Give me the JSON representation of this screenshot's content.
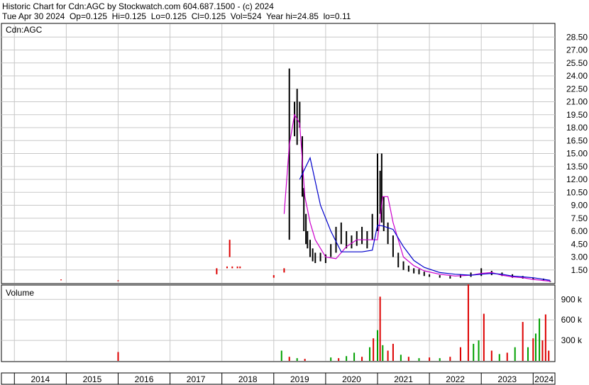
{
  "header": {
    "line1": "Historic Chart for Cdn:AGC by Stockwatch.com 604.687.1500 - (c) 2024",
    "line2": "Tue Apr 30 2024  Op=0.125  Hi=0.125  Lo=0.125  Cl=0.125  Vol=524  Year hi=24.85  lo=0.11"
  },
  "colors": {
    "grid": "#c8c8c8",
    "price_bars": "#000000",
    "ma_short": "#cc00cc",
    "ma_long": "#0000cc",
    "volume_up": "#00a000",
    "volume_down": "#dd0000",
    "early_ticks": "#dd0000"
  },
  "chart_data": [
    {
      "type": "line",
      "panel": "price",
      "title": "Cdn:AGC",
      "ylim": [
        0,
        30
      ],
      "y_ticks": [
        "1.50",
        "3.00",
        "4.50",
        "6.00",
        "7.50",
        "9.00",
        "10.50",
        "12.00",
        "13.50",
        "15.00",
        "16.50",
        "18.00",
        "19.50",
        "21.00",
        "22.50",
        "24.00",
        "25.50",
        "27.00",
        "28.50"
      ],
      "x_ticks": [
        "2014",
        "2015",
        "2016",
        "2017",
        "2018",
        "2019",
        "2020",
        "2021",
        "2022",
        "2023",
        "2024"
      ],
      "series": [
        {
          "style": "price-range",
          "x": [
            2014.9,
            2016.0,
            2017.9,
            2018.1,
            2018.15,
            2018.2,
            2018.3,
            2018.35,
            2019.0,
            2019.2,
            2019.3,
            2019.4,
            2019.45,
            2019.5,
            2019.55,
            2019.58,
            2019.62,
            2019.65,
            2019.7,
            2019.75,
            2019.8,
            2019.9,
            2020.0,
            2020.1,
            2020.2,
            2020.3,
            2020.4,
            2020.5,
            2020.6,
            2020.7,
            2020.8,
            2020.9,
            2021.0,
            2021.05,
            2021.08,
            2021.12,
            2021.2,
            2021.3,
            2021.4,
            2021.5,
            2021.6,
            2021.7,
            2021.8,
            2021.9,
            2022.0,
            2022.2,
            2022.4,
            2022.6,
            2022.8,
            2023.0,
            2023.2,
            2023.4,
            2023.6,
            2023.8,
            2024.0,
            2024.2,
            2024.33
          ],
          "low": [
            0.3,
            0.2,
            1.0,
            1.7,
            3.0,
            1.7,
            1.7,
            1.7,
            0.6,
            1.2,
            5.0,
            17.0,
            16.0,
            18.0,
            10.0,
            6.0,
            4.5,
            4.0,
            3.0,
            2.5,
            2.3,
            2.5,
            2.3,
            3.0,
            3.5,
            4.5,
            4.0,
            4.0,
            4.3,
            4.5,
            4.0,
            5.0,
            6.0,
            8.0,
            7.0,
            6.0,
            4.5,
            3.0,
            1.8,
            1.5,
            1.3,
            1.1,
            1.0,
            0.8,
            0.7,
            0.6,
            0.5,
            0.6,
            0.7,
            0.8,
            0.9,
            0.8,
            0.6,
            0.5,
            0.4,
            0.3,
            0.11
          ],
          "high": [
            0.4,
            0.3,
            1.7,
            1.9,
            5.0,
            1.9,
            1.9,
            1.9,
            0.9,
            1.7,
            24.85,
            21.0,
            22.5,
            21.0,
            17.0,
            11.0,
            8.0,
            6.0,
            5.0,
            4.0,
            3.5,
            3.5,
            3.3,
            4.5,
            6.5,
            7.0,
            6.0,
            5.5,
            6.0,
            6.5,
            6.0,
            8.0,
            15.0,
            13.0,
            15.0,
            10.0,
            7.0,
            5.5,
            3.5,
            2.5,
            2.0,
            1.7,
            1.6,
            1.3,
            1.0,
            0.9,
            0.8,
            1.0,
            1.2,
            1.7,
            1.4,
            1.2,
            1.0,
            0.8,
            0.6,
            0.5,
            0.2
          ]
        },
        {
          "name": "",
          "style": "ma-short",
          "x": [
            2019.2,
            2019.3,
            2019.4,
            2019.5,
            2019.6,
            2019.7,
            2019.8,
            2019.9,
            2020.0,
            2020.2,
            2020.4,
            2020.6,
            2020.8,
            2021.0,
            2021.1,
            2021.2,
            2021.3,
            2021.5,
            2021.7,
            2021.9,
            2022.2,
            2022.5,
            2022.8,
            2023.0,
            2023.2,
            2023.4,
            2023.6,
            2023.8,
            2024.0,
            2024.33
          ],
          "values": [
            8.0,
            16.0,
            19.5,
            18.5,
            10.0,
            7.0,
            5.0,
            4.0,
            3.0,
            2.8,
            4.2,
            5.0,
            5.0,
            5.0,
            10.0,
            10.0,
            7.0,
            3.0,
            2.0,
            1.4,
            1.0,
            0.8,
            0.9,
            1.1,
            1.2,
            0.9,
            0.7,
            0.6,
            0.4,
            0.2
          ]
        },
        {
          "name": "",
          "style": "ma-long",
          "x": [
            2019.5,
            2019.7,
            2019.9,
            2020.1,
            2020.3,
            2020.5,
            2020.7,
            2020.9,
            2021.0,
            2021.1,
            2021.3,
            2021.5,
            2021.7,
            2021.9,
            2022.2,
            2022.5,
            2022.8,
            2023.0,
            2023.2,
            2023.4,
            2023.6,
            2023.8,
            2024.0,
            2024.33
          ],
          "values": [
            12.0,
            14.5,
            9.0,
            6.0,
            3.6,
            3.6,
            3.6,
            3.8,
            6.7,
            6.6,
            6.2,
            4.2,
            2.6,
            1.8,
            1.2,
            1.0,
            0.9,
            1.0,
            1.1,
            1.0,
            0.8,
            0.7,
            0.6,
            0.3
          ]
        }
      ]
    },
    {
      "type": "bar",
      "panel": "volume",
      "title": "Volume",
      "ylim": [
        0,
        1100000
      ],
      "y_ticks": [
        "300 k",
        "600 k",
        "900 k"
      ],
      "bars": [
        {
          "x": 2016.0,
          "value": 130000,
          "dir": "down"
        },
        {
          "x": 2019.15,
          "value": 150000,
          "dir": "up"
        },
        {
          "x": 2019.3,
          "value": 60000,
          "dir": "down"
        },
        {
          "x": 2019.45,
          "value": 40000,
          "dir": "up"
        },
        {
          "x": 2019.6,
          "value": 30000,
          "dir": "down"
        },
        {
          "x": 2020.1,
          "value": 50000,
          "dir": "up"
        },
        {
          "x": 2020.25,
          "value": 40000,
          "dir": "down"
        },
        {
          "x": 2020.4,
          "value": 70000,
          "dir": "up"
        },
        {
          "x": 2020.55,
          "value": 120000,
          "dir": "up"
        },
        {
          "x": 2020.7,
          "value": 60000,
          "dir": "down"
        },
        {
          "x": 2020.85,
          "value": 200000,
          "dir": "up"
        },
        {
          "x": 2020.92,
          "value": 330000,
          "dir": "down"
        },
        {
          "x": 2021.0,
          "value": 450000,
          "dir": "up"
        },
        {
          "x": 2021.05,
          "value": 940000,
          "dir": "down"
        },
        {
          "x": 2021.1,
          "value": 230000,
          "dir": "up"
        },
        {
          "x": 2021.2,
          "value": 150000,
          "dir": "down"
        },
        {
          "x": 2021.3,
          "value": 250000,
          "dir": "down"
        },
        {
          "x": 2021.45,
          "value": 90000,
          "dir": "up"
        },
        {
          "x": 2021.6,
          "value": 60000,
          "dir": "down"
        },
        {
          "x": 2021.8,
          "value": 40000,
          "dir": "up"
        },
        {
          "x": 2022.0,
          "value": 50000,
          "dir": "down"
        },
        {
          "x": 2022.2,
          "value": 40000,
          "dir": "up"
        },
        {
          "x": 2022.4,
          "value": 60000,
          "dir": "down"
        },
        {
          "x": 2022.6,
          "value": 200000,
          "dir": "down"
        },
        {
          "x": 2022.75,
          "value": 1120000,
          "dir": "down"
        },
        {
          "x": 2022.85,
          "value": 250000,
          "dir": "up"
        },
        {
          "x": 2022.95,
          "value": 300000,
          "dir": "up"
        },
        {
          "x": 2023.05,
          "value": 690000,
          "dir": "down"
        },
        {
          "x": 2023.2,
          "value": 150000,
          "dir": "down"
        },
        {
          "x": 2023.35,
          "value": 100000,
          "dir": "up"
        },
        {
          "x": 2023.5,
          "value": 120000,
          "dir": "down"
        },
        {
          "x": 2023.65,
          "value": 200000,
          "dir": "up"
        },
        {
          "x": 2023.8,
          "value": 570000,
          "dir": "down"
        },
        {
          "x": 2023.9,
          "value": 200000,
          "dir": "up"
        },
        {
          "x": 2024.0,
          "value": 330000,
          "dir": "down"
        },
        {
          "x": 2024.05,
          "value": 400000,
          "dir": "up"
        },
        {
          "x": 2024.12,
          "value": 620000,
          "dir": "up"
        },
        {
          "x": 2024.18,
          "value": 300000,
          "dir": "down"
        },
        {
          "x": 2024.24,
          "value": 680000,
          "dir": "down"
        },
        {
          "x": 2024.3,
          "value": 150000,
          "dir": "down"
        }
      ]
    }
  ]
}
